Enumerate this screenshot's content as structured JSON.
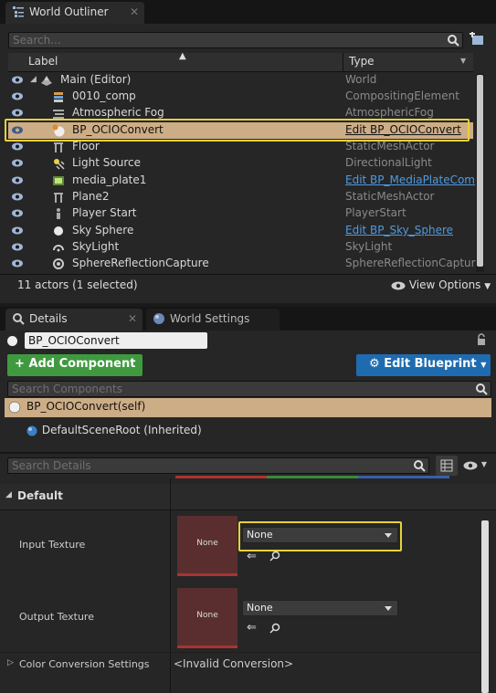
{
  "outliner": {
    "tab_title": "World Outliner",
    "search_placeholder": "Search...",
    "col_label": "Label",
    "col_type": "Type",
    "rows": [
      {
        "label": "Main (Editor)",
        "type": "World",
        "link": false,
        "icon": "world-icon"
      },
      {
        "label": "0010_comp",
        "type": "CompositingElement",
        "link": false,
        "icon": "compositing-icon"
      },
      {
        "label": "Atmospheric Fog",
        "type": "AtmosphericFog",
        "link": false,
        "icon": "fog-icon"
      },
      {
        "label": "BP_OCIOConvert",
        "type": "Edit BP_OCIOConvert",
        "link": true,
        "icon": "blueprint-sphere-icon"
      },
      {
        "label": "Floor",
        "type": "StaticMeshActor",
        "link": false,
        "icon": "static-mesh-icon"
      },
      {
        "label": "Light Source",
        "type": "DirectionalLight",
        "link": false,
        "icon": "light-icon"
      },
      {
        "label": "media_plate1",
        "type": "Edit BP_MediaPlateComp",
        "link": true,
        "icon": "media-plate-icon"
      },
      {
        "label": "Plane2",
        "type": "StaticMeshActor",
        "link": false,
        "icon": "static-mesh-icon"
      },
      {
        "label": "Player Start",
        "type": "PlayerStart",
        "link": false,
        "icon": "player-start-icon"
      },
      {
        "label": "Sky Sphere",
        "type": "Edit BP_Sky_Sphere",
        "link": true,
        "icon": "sphere-icon"
      },
      {
        "label": "SkyLight",
        "type": "SkyLight",
        "link": false,
        "icon": "skylight-icon"
      },
      {
        "label": "SphereReflectionCapture",
        "type": "SphereReflectionCapture",
        "link": false,
        "icon": "reflection-capture-icon"
      }
    ],
    "status": "11 actors (1 selected)",
    "view_options": "View Options"
  },
  "details": {
    "tab_details": "Details",
    "tab_world_settings": "World Settings",
    "actor_name": "BP_OCIOConvert",
    "add_component": "Add Component",
    "edit_blueprint": "Edit Blueprint",
    "search_components_placeholder": "Search Components",
    "component_self": "BP_OCIOConvert(self)",
    "component_root": "DefaultSceneRoot (Inherited)",
    "search_details_placeholder": "Search Details",
    "section_default": "Default",
    "input_texture_label": "Input Texture",
    "input_texture_thumb": "None",
    "input_texture_value": "None",
    "output_texture_label": "Output Texture",
    "output_texture_thumb": "None",
    "output_texture_value": "None",
    "color_conversion_label": "Color Conversion Settings",
    "color_conversion_value": "<Invalid Conversion>"
  },
  "colors": {
    "selection": "#cdad86",
    "highlight_border": "#e6d23a",
    "add_component_green": "#3f9a3f",
    "edit_blueprint_blue": "#1f6bb0",
    "link": "#4e9ae0"
  }
}
